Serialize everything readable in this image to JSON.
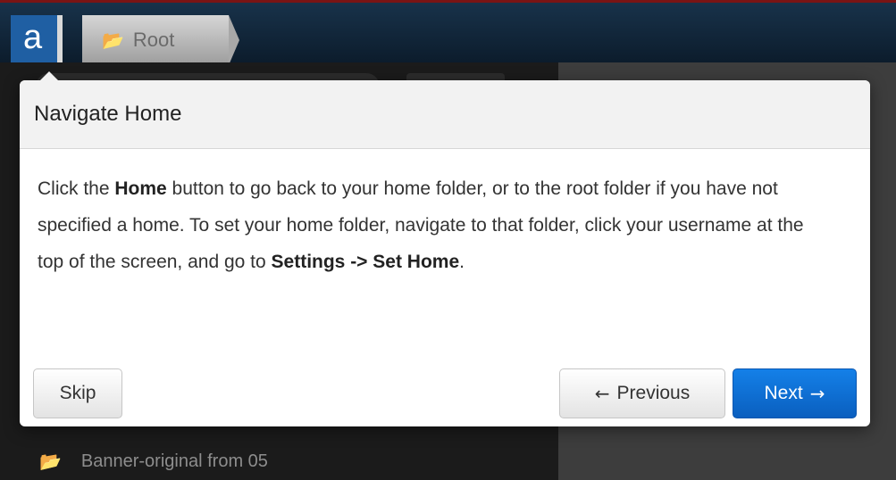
{
  "header": {
    "logo_letter": "a",
    "breadcrumb_label": "Root",
    "breadcrumb_icon": "folder-open-icon"
  },
  "sidebar": {
    "folders": [
      {
        "label": "Banner-original from 05",
        "icon": "folder-open-icon"
      }
    ]
  },
  "tour": {
    "title": "Navigate Home",
    "body": {
      "part1": "Click the ",
      "bold1": "Home",
      "part2": " button to go back to your home folder, or to the root folder if you have not specified a home. To set your home folder, navigate to that folder, click your username at the top of the screen, and go to ",
      "bold2": "Settings -> Set Home",
      "part3": "."
    },
    "buttons": {
      "skip": "Skip",
      "previous": "Previous",
      "next": "Next"
    }
  },
  "colors": {
    "next_button": "#0a6fd8",
    "logo_background": "#1f5fa3",
    "header_background": "#0c1c2c"
  }
}
